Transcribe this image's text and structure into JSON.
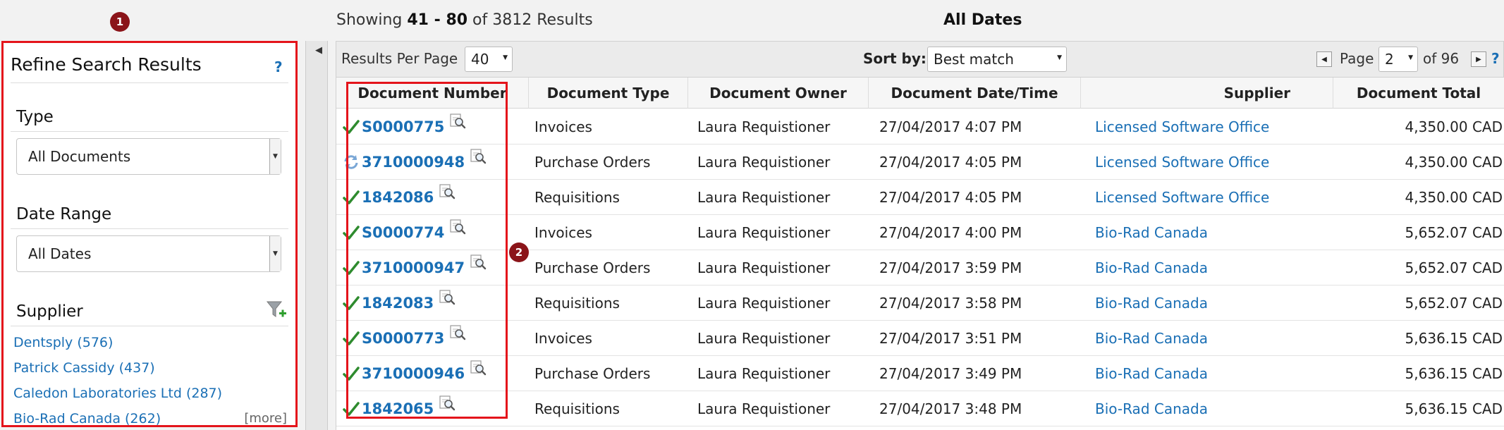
{
  "badges": {
    "one": "1",
    "two": "2"
  },
  "header": {
    "showing_prefix": "Showing ",
    "range": "41 - 80",
    "of_text": " of 3812 Results",
    "date_filter_title": "All Dates"
  },
  "refine": {
    "title": "Refine Search Results",
    "help": "?",
    "type_label": "Type",
    "type_value": "All Documents",
    "date_label": "Date Range",
    "date_value": "All Dates",
    "supplier_label": "Supplier",
    "suppliers": [
      "Dentsply (576)",
      "Patrick Cassidy (437)",
      "Caledon Laboratories Ltd (287)",
      "Bio-Rad Canada (262)"
    ],
    "more": "[more]"
  },
  "toolbar": {
    "per_page_label": "Results Per Page",
    "per_page_value": "40",
    "sort_label": "Sort by:",
    "sort_value": "Best match",
    "page_label": "Page",
    "page_value": "2",
    "of_pages": "of 96",
    "help": "?"
  },
  "table": {
    "headers": [
      "Document Number",
      "Document Type",
      "Document Owner",
      "Document Date/Time",
      "Supplier",
      "Document Total"
    ],
    "rows": [
      {
        "status": "check",
        "number": "S0000775",
        "type": "Invoices",
        "owner": "Laura Requistioner",
        "date": "27/04/2017 4:07 PM",
        "supplier": "Licensed Software Office",
        "total": "4,350.00 CAD"
      },
      {
        "status": "sync",
        "number": "3710000948",
        "type": "Purchase Orders",
        "owner": "Laura Requistioner",
        "date": "27/04/2017 4:05 PM",
        "supplier": "Licensed Software Office",
        "total": "4,350.00 CAD"
      },
      {
        "status": "check",
        "number": "1842086",
        "type": "Requisitions",
        "owner": "Laura Requistioner",
        "date": "27/04/2017 4:05 PM",
        "supplier": "Licensed Software Office",
        "total": "4,350.00 CAD"
      },
      {
        "status": "check",
        "number": "S0000774",
        "type": "Invoices",
        "owner": "Laura Requistioner",
        "date": "27/04/2017 4:00 PM",
        "supplier": "Bio-Rad Canada",
        "total": "5,652.07 CAD"
      },
      {
        "status": "check",
        "number": "3710000947",
        "type": "Purchase Orders",
        "owner": "Laura Requistioner",
        "date": "27/04/2017 3:59 PM",
        "supplier": "Bio-Rad Canada",
        "total": "5,652.07 CAD"
      },
      {
        "status": "check",
        "number": "1842083",
        "type": "Requisitions",
        "owner": "Laura Requistioner",
        "date": "27/04/2017 3:58 PM",
        "supplier": "Bio-Rad Canada",
        "total": "5,652.07 CAD"
      },
      {
        "status": "check",
        "number": "S0000773",
        "type": "Invoices",
        "owner": "Laura Requistioner",
        "date": "27/04/2017 3:51 PM",
        "supplier": "Bio-Rad Canada",
        "total": "5,636.15 CAD"
      },
      {
        "status": "check",
        "number": "3710000946",
        "type": "Purchase Orders",
        "owner": "Laura Requistioner",
        "date": "27/04/2017 3:49 PM",
        "supplier": "Bio-Rad Canada",
        "total": "5,636.15 CAD"
      },
      {
        "status": "check",
        "number": "1842065",
        "type": "Requisitions",
        "owner": "Laura Requistioner",
        "date": "27/04/2017 3:48 PM",
        "supplier": "Bio-Rad Canada",
        "total": "5,636.15 CAD"
      }
    ]
  }
}
